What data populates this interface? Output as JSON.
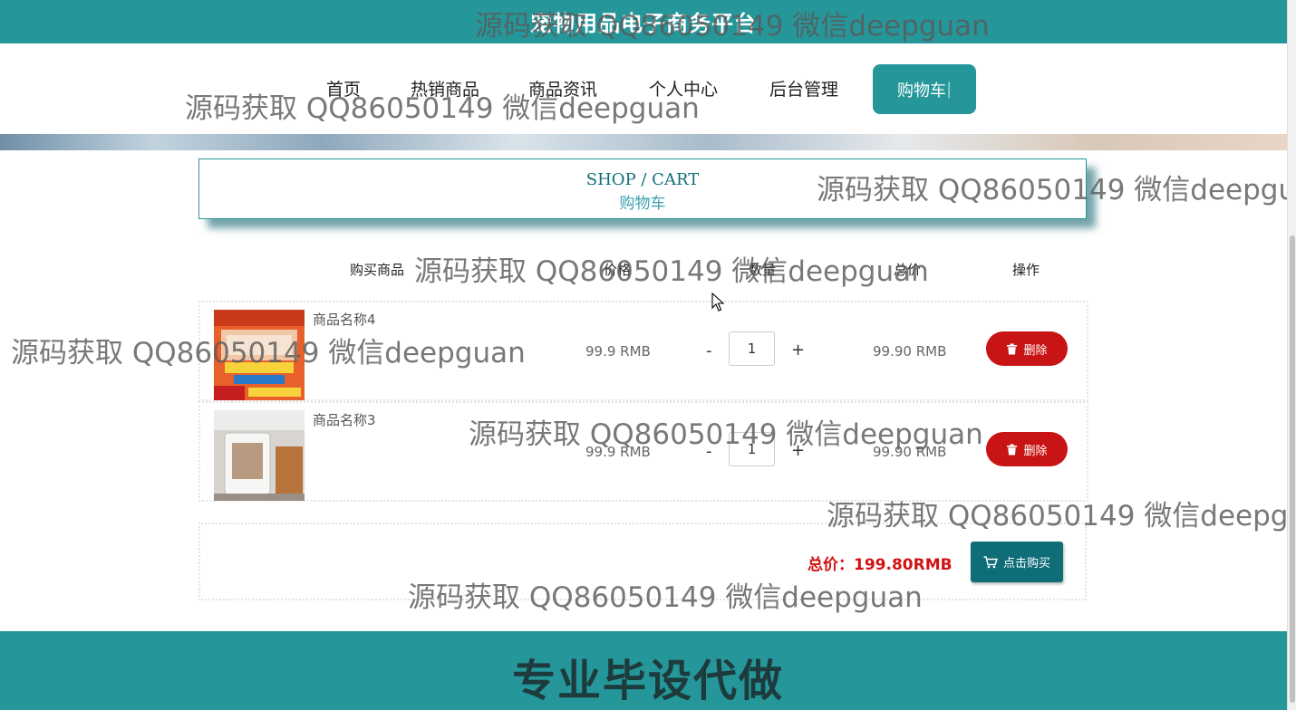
{
  "app": {
    "title": "宠物用品电子商务平台"
  },
  "nav": {
    "items": [
      "首页",
      "热销商品",
      "商品资讯",
      "个人中心",
      "后台管理"
    ],
    "cart_label": "购物车"
  },
  "shop_header": {
    "en": "SHOP / CART",
    "cn": "购物车"
  },
  "table": {
    "headers": [
      "购买商品",
      "价格",
      "数量",
      "总价",
      "操作"
    ]
  },
  "cart": {
    "items": [
      {
        "name": "商品名称4",
        "price": "99.9 RMB",
        "quantity": "1",
        "total": "99.90 RMB",
        "delete_label": "删除"
      },
      {
        "name": "商品名称3",
        "price": "99.9 RMB",
        "quantity": "1",
        "total": "99.90 RMB",
        "delete_label": "删除"
      }
    ],
    "minus": "-",
    "plus": "+"
  },
  "summary": {
    "total_text": "总价：199.80RMB",
    "buy_label": "点击购买"
  },
  "footer": {
    "banner": "专业毕设代做"
  },
  "watermark": {
    "text": "源码获取 QQ86050149 微信deepguan"
  },
  "colors": {
    "primary": "#25979a",
    "delete": "#c81414",
    "buy": "#0f6d78",
    "total": "#d21212"
  }
}
